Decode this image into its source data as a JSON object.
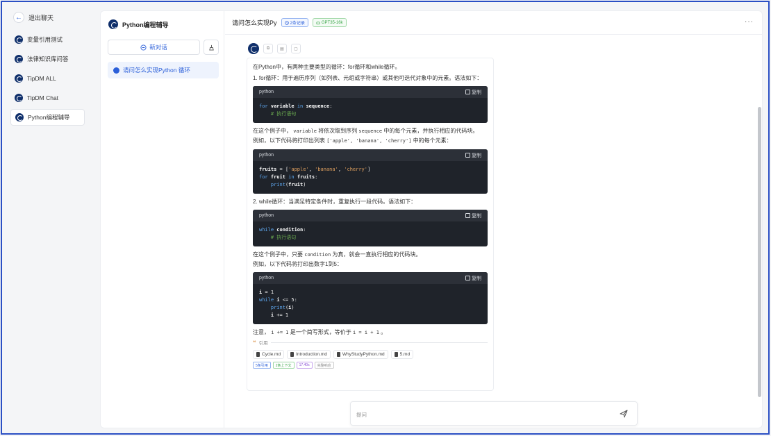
{
  "app_sidebar": {
    "exit_label": "退出聊天",
    "items": [
      {
        "label": "变量引用测试"
      },
      {
        "label": "法律知识库问答"
      },
      {
        "label": "TipDM ALL"
      },
      {
        "label": "TipDM Chat"
      },
      {
        "label": "Python编程辅导"
      }
    ]
  },
  "chat_sidebar": {
    "title": "Python编程辅导",
    "new_chat_label": "新对话",
    "history": [
      {
        "label": "请问怎么实现Python 循环"
      }
    ]
  },
  "chat_header": {
    "title": "请问怎么实现Py",
    "record_tag": "2条记录",
    "model_tag": "GPT35-16k",
    "more": "···"
  },
  "answer": {
    "p1": "在Python中，有两种主要类型的循环：for循环和while循环。",
    "p2": "1. for循环：用于遍历序列（如列表、元组或字符串）或其他可迭代对象中的元素。语法如下：",
    "code_lang": "python",
    "copy_label": "复制",
    "p3_a": "在这个例子中，",
    "p3_code1": "variable",
    "p3_b": "将依次取到序列",
    "p3_code2": "sequence",
    "p3_c": "中的每个元素，并执行相应的代码块。",
    "p4_a": "例如，以下代码将打印出列表",
    "p4_code": "['apple', 'banana', 'cherry']",
    "p4_b": "中的每个元素：",
    "p5": "2. while循环：当满足特定条件时，重复执行一段代码。语法如下：",
    "p6_a": "在这个例子中，只要",
    "p6_code": "condition",
    "p6_b": "为真，就会一直执行相应的代码块。",
    "p7": "例如，以下代码将打印出数字1到5：",
    "p8_a": "注意，",
    "p8_code1": "i += 1",
    "p8_b": "是一个简写形式，等价于",
    "p8_code2": "i = i + 1",
    "p8_c": "。",
    "quote_label": "引用",
    "files": [
      "Cycle.md",
      "Introduction.md",
      "WhyStudyPython.md",
      "5.md"
    ],
    "badges": [
      "5条引用",
      "2条上下文",
      "17.40s",
      "完整响应"
    ]
  },
  "input": {
    "placeholder": "提问"
  },
  "colors": {
    "accent": "#2b5fd9",
    "frame": "#2b4fc4",
    "code_bg": "#1f232a"
  }
}
